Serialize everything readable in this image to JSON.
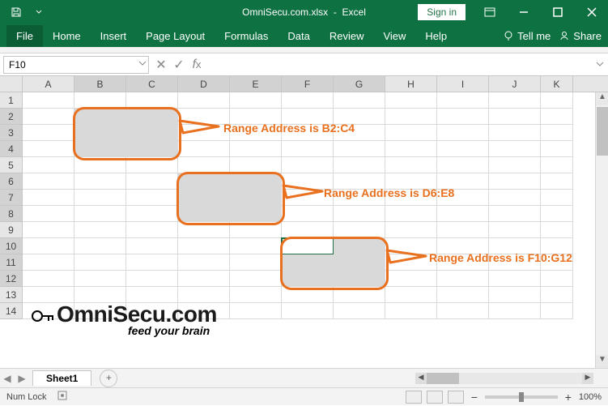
{
  "title": {
    "filename": "OmniSecu.com.xlsx",
    "app": "Excel"
  },
  "signin": "Sign in",
  "ribbon": {
    "tabs": [
      "File",
      "Home",
      "Insert",
      "Page Layout",
      "Formulas",
      "Data",
      "Review",
      "View",
      "Help"
    ],
    "tellme": "Tell me",
    "share": "Share"
  },
  "namebox": "F10",
  "columns": [
    "A",
    "B",
    "C",
    "D",
    "E",
    "F",
    "G",
    "H",
    "I",
    "J",
    "K"
  ],
  "rows": [
    "1",
    "2",
    "3",
    "4",
    "5",
    "6",
    "7",
    "8",
    "9",
    "10",
    "11",
    "12",
    "13",
    "14"
  ],
  "selected_cols": [
    "B",
    "C",
    "D",
    "E",
    "F",
    "G"
  ],
  "selected_rows": [
    "2",
    "3",
    "4",
    "6",
    "7",
    "8",
    "10",
    "11",
    "12"
  ],
  "active_cell": "F10",
  "selections": [
    {
      "range": "B2:C4",
      "label": "Range Address is B2:C4"
    },
    {
      "range": "D6:E8",
      "label": "Range Address is D6:E8"
    },
    {
      "range": "F10:G12",
      "label": "Range Address is F10:G12"
    }
  ],
  "callouts": {
    "r1": "Range Address is B2:C4",
    "r2": "Range Address is D6:E8",
    "r3": "Range Address is F10:G12"
  },
  "watermark": {
    "brand": "OmniSecu.com",
    "tag": "feed your brain"
  },
  "sheet_tab": "Sheet1",
  "statusbar": {
    "numlock": "Num Lock",
    "zoom": "100%"
  }
}
